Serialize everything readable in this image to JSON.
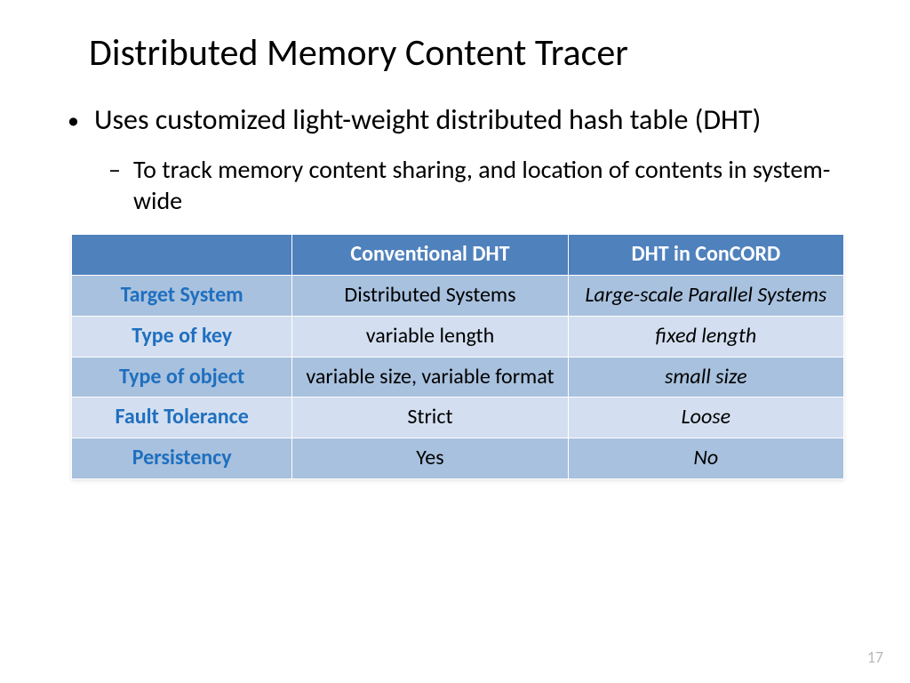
{
  "title": "Distributed Memory Content Tracer",
  "bullets": {
    "l1": "Uses customized light-weight distributed hash table (DHT)",
    "l2": "To track memory content sharing, and location of contents in system-wide"
  },
  "table": {
    "headers": {
      "h1": "",
      "h2": "Conventional DHT",
      "h3": "DHT in ConCORD"
    },
    "rows": [
      {
        "label": "Target System",
        "c2": "Distributed Systems",
        "c3": "Large-scale Parallel Systems"
      },
      {
        "label": "Type of key",
        "c2": "variable length",
        "c3": "fixed length"
      },
      {
        "label": "Type of object",
        "c2": "variable size, variable format",
        "c3": "small size"
      },
      {
        "label": "Fault Tolerance",
        "c2": "Strict",
        "c3": "Loose"
      },
      {
        "label": "Persistency",
        "c2": "Yes",
        "c3": "No"
      }
    ]
  },
  "pagenum": "17",
  "chart_data": {
    "type": "table",
    "title": "Distributed Memory Content Tracer — DHT comparison",
    "columns": [
      "",
      "Conventional DHT",
      "DHT in ConCORD"
    ],
    "rows": [
      [
        "Target System",
        "Distributed Systems",
        "Large-scale Parallel Systems"
      ],
      [
        "Type of key",
        "variable length",
        "fixed length"
      ],
      [
        "Type of object",
        "variable size, variable format",
        "small size"
      ],
      [
        "Fault Tolerance",
        "Strict",
        "Loose"
      ],
      [
        "Persistency",
        "Yes",
        "No"
      ]
    ]
  }
}
